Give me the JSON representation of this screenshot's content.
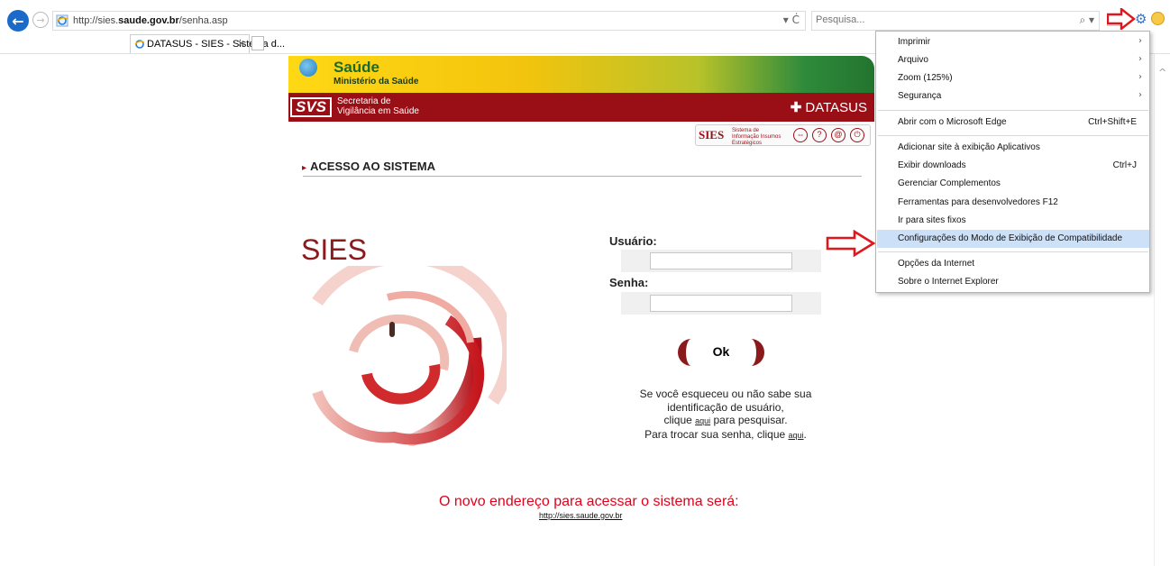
{
  "browser": {
    "url_prefix": "http://sies.",
    "url_domain": "saude.gov.br",
    "url_path": "/senha.asp",
    "address_controls": "▾ Ċ",
    "search_placeholder": "Pesquisa...",
    "search_controls": "⌕ ▾",
    "tab_title": "DATASUS - SIES - Sistema d...",
    "tab_close": "✕"
  },
  "banner": {
    "saude": "Saúde",
    "ministerio": "Ministério da Saúde",
    "svs": "SVS",
    "secretaria_line1": "Secretaria de",
    "secretaria_line2": "Vigilância em Saúde",
    "datasus": "DATASUS",
    "datasus_cross": "✚",
    "sies_badge": "SIES",
    "sies_badge_sub": "Sistema de Informação Insumos Estratégicos"
  },
  "page": {
    "access_title": "ACESSO AO SISTEMA",
    "sies_logo": "SIES",
    "user_label": "Usuário:",
    "password_label": "Senha:",
    "ok_label": "Ok",
    "help_line1": "Se você esqueceu ou não sabe sua",
    "help_line2": "identificação de usuário,",
    "help_line3a": "clique ",
    "help_link1": "aqui",
    "help_line3b": " para pesquisar.",
    "help_line4a": "Para trocar sua senha, clique ",
    "help_link2": "aqui",
    "help_line4b": ".",
    "new_address_title": "O novo endereço para acessar o sistema será:",
    "new_address_link": "http://sies.saude.gov.br"
  },
  "tools_menu": {
    "items": [
      {
        "label": "Imprimir",
        "arrow": "›"
      },
      {
        "label": "Arquivo",
        "arrow": "›"
      },
      {
        "label": "Zoom (125%)",
        "arrow": "›"
      },
      {
        "label": "Segurança",
        "arrow": "›"
      },
      {
        "label": "Abrir com o Microsoft Edge",
        "shortcut": "Ctrl+Shift+E"
      },
      {
        "label": "Adicionar site à exibição Aplicativos"
      },
      {
        "label": "Exibir downloads",
        "shortcut": "Ctrl+J"
      },
      {
        "label": "Gerenciar Complementos"
      },
      {
        "label": "Ferramentas para desenvolvedores F12"
      },
      {
        "label": "Ir para sites fixos"
      },
      {
        "label": "Configurações do Modo de Exibição de Compatibilidade"
      },
      {
        "label": "Opções da Internet"
      },
      {
        "label": "Sobre o Internet Explorer"
      }
    ]
  },
  "colors": {
    "accent_red": "#9a0f16",
    "arrow_red": "#e0161c",
    "menu_highlight": "#cce0f8",
    "new_address_red": "#e2001a"
  },
  "icons": {
    "back": "back-arrow-icon",
    "forward": "forward-arrow-icon",
    "gear": "gear-icon",
    "smiley": "smiley-feedback-icon"
  }
}
